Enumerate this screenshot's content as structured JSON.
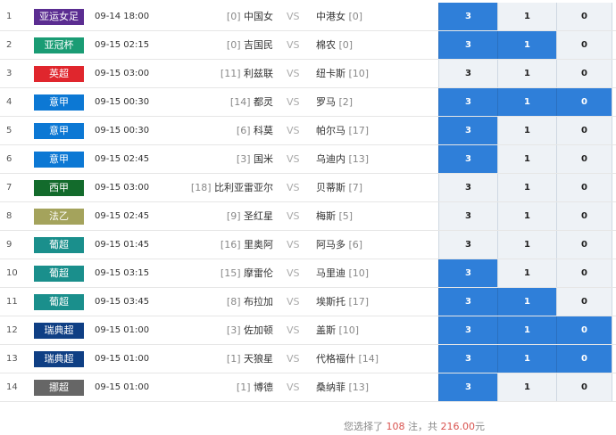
{
  "colors": {
    "selected_odd": "#2f7fd9",
    "unselected_odd": "#eef2f6",
    "highlight": "#d9534f"
  },
  "matches": [
    {
      "num": "1",
      "league": "亚运女足",
      "league_color": "#5b2d91",
      "time": "09-14 18:00",
      "home_rank": "[0]",
      "home": "中国女",
      "vs": "VS",
      "away": "中港女",
      "away_rank": "[0]",
      "odds": [
        "3",
        "1",
        "0"
      ],
      "selected": [
        true,
        false,
        false
      ]
    },
    {
      "num": "2",
      "league": "亚冠杯",
      "league_color": "#1a9c74",
      "time": "09-15 02:15",
      "home_rank": "[0]",
      "home": "吉国民",
      "vs": "VS",
      "away": "棉农",
      "away_rank": "[0]",
      "odds": [
        "3",
        "1",
        "0"
      ],
      "selected": [
        true,
        true,
        false
      ]
    },
    {
      "num": "3",
      "league": "英超",
      "league_color": "#e0262d",
      "time": "09-15 03:00",
      "home_rank": "[11]",
      "home": "利兹联",
      "vs": "VS",
      "away": "纽卡斯",
      "away_rank": "[10]",
      "odds": [
        "3",
        "1",
        "0"
      ],
      "selected": [
        false,
        false,
        false
      ]
    },
    {
      "num": "4",
      "league": "意甲",
      "league_color": "#0c78d4",
      "time": "09-15 00:30",
      "home_rank": "[14]",
      "home": "都灵",
      "vs": "VS",
      "away": "罗马",
      "away_rank": "[2]",
      "odds": [
        "3",
        "1",
        "0"
      ],
      "selected": [
        true,
        true,
        true
      ]
    },
    {
      "num": "5",
      "league": "意甲",
      "league_color": "#0c78d4",
      "time": "09-15 00:30",
      "home_rank": "[6]",
      "home": "科莫",
      "vs": "VS",
      "away": "帕尔马",
      "away_rank": "[17]",
      "odds": [
        "3",
        "1",
        "0"
      ],
      "selected": [
        true,
        false,
        false
      ]
    },
    {
      "num": "6",
      "league": "意甲",
      "league_color": "#0c78d4",
      "time": "09-15 02:45",
      "home_rank": "[3]",
      "home": "国米",
      "vs": "VS",
      "away": "乌迪内",
      "away_rank": "[13]",
      "odds": [
        "3",
        "1",
        "0"
      ],
      "selected": [
        true,
        false,
        false
      ]
    },
    {
      "num": "7",
      "league": "西甲",
      "league_color": "#136b2c",
      "time": "09-15 03:00",
      "home_rank": "[18]",
      "home": "比利亚雷亚尔",
      "vs": "VS",
      "away": "贝蒂斯",
      "away_rank": "[7]",
      "odds": [
        "3",
        "1",
        "0"
      ],
      "selected": [
        false,
        false,
        false
      ]
    },
    {
      "num": "8",
      "league": "法乙",
      "league_color": "#a4a35c",
      "time": "09-15 02:45",
      "home_rank": "[9]",
      "home": "圣红星",
      "vs": "VS",
      "away": "梅斯",
      "away_rank": "[5]",
      "odds": [
        "3",
        "1",
        "0"
      ],
      "selected": [
        false,
        false,
        false
      ]
    },
    {
      "num": "9",
      "league": "葡超",
      "league_color": "#1a8f8c",
      "time": "09-15 01:45",
      "home_rank": "[16]",
      "home": "里奥阿",
      "vs": "VS",
      "away": "阿马多",
      "away_rank": "[6]",
      "odds": [
        "3",
        "1",
        "0"
      ],
      "selected": [
        false,
        false,
        false
      ]
    },
    {
      "num": "10",
      "league": "葡超",
      "league_color": "#1a8f8c",
      "time": "09-15 03:15",
      "home_rank": "[15]",
      "home": "摩雷伦",
      "vs": "VS",
      "away": "马里迪",
      "away_rank": "[10]",
      "odds": [
        "3",
        "1",
        "0"
      ],
      "selected": [
        true,
        false,
        false
      ]
    },
    {
      "num": "11",
      "league": "葡超",
      "league_color": "#1a8f8c",
      "time": "09-15 03:45",
      "home_rank": "[8]",
      "home": "布拉加",
      "vs": "VS",
      "away": "埃斯托",
      "away_rank": "[17]",
      "odds": [
        "3",
        "1",
        "0"
      ],
      "selected": [
        true,
        true,
        false
      ]
    },
    {
      "num": "12",
      "league": "瑞典超",
      "league_color": "#0f3f84",
      "time": "09-15 01:00",
      "home_rank": "[3]",
      "home": "佐加顿",
      "vs": "VS",
      "away": "盖斯",
      "away_rank": "[10]",
      "odds": [
        "3",
        "1",
        "0"
      ],
      "selected": [
        true,
        true,
        true
      ]
    },
    {
      "num": "13",
      "league": "瑞典超",
      "league_color": "#0f3f84",
      "time": "09-15 01:00",
      "home_rank": "[1]",
      "home": "天狼星",
      "vs": "VS",
      "away": "代格福什",
      "away_rank": "[14]",
      "odds": [
        "3",
        "1",
        "0"
      ],
      "selected": [
        true,
        true,
        true
      ]
    },
    {
      "num": "14",
      "league": "挪超",
      "league_color": "#666666",
      "time": "09-15 01:00",
      "home_rank": "[1]",
      "home": "博德",
      "vs": "VS",
      "away": "桑纳菲",
      "away_rank": "[13]",
      "odds": [
        "3",
        "1",
        "0"
      ],
      "selected": [
        true,
        false,
        false
      ]
    }
  ],
  "summary": {
    "prefix": "您选择了",
    "count": "108",
    "middle": "注，共",
    "amount": "216.00",
    "suffix": "元"
  }
}
